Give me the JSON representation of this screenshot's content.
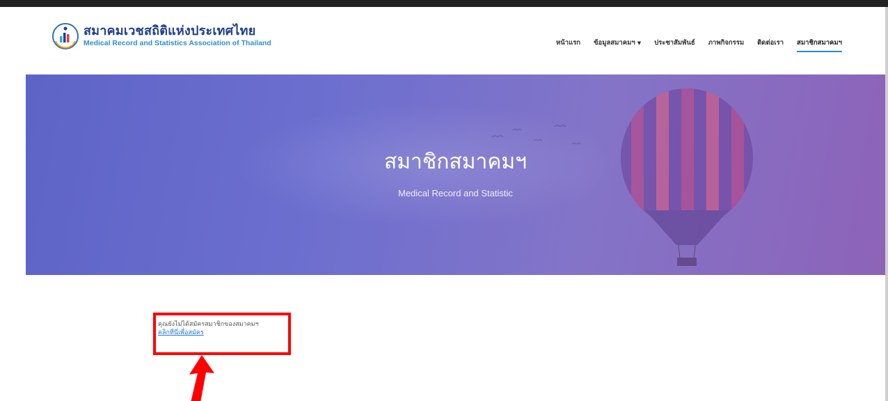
{
  "header": {
    "logo": {
      "title_th": "สมาคมเวชสถิติแห่งประเทศไทย",
      "title_en": "Medical Record and Statistics Association of Thailand"
    },
    "nav": [
      {
        "label": "หน้าแรก",
        "has_dropdown": false,
        "active": false
      },
      {
        "label": "ข้อมูลสมาคมฯ",
        "has_dropdown": true,
        "active": false
      },
      {
        "label": "ประชาสัมพันธ์",
        "has_dropdown": false,
        "active": false
      },
      {
        "label": "ภาพกิจกรรม",
        "has_dropdown": false,
        "active": false
      },
      {
        "label": "ติดต่อเรา",
        "has_dropdown": false,
        "active": false
      },
      {
        "label": "สมาชิกสมาคมฯ",
        "has_dropdown": false,
        "active": true
      }
    ]
  },
  "banner": {
    "title": "สมาชิกสมาคมฯ",
    "subtitle": "Medical Record and Statistic"
  },
  "content": {
    "notice_text": "คุณยังไม่ได้สมัครสมาชิกของสมาคมฯ",
    "register_link": "คลิกที่นี่เพื่อสมัคร"
  },
  "annotation": {
    "highlight_color": "#ff0000"
  },
  "colors": {
    "accent": "#1f8cd8",
    "logo_primary": "#1f3f8f",
    "logo_secondary": "#2f8fd0",
    "link": "#1a78d2"
  }
}
